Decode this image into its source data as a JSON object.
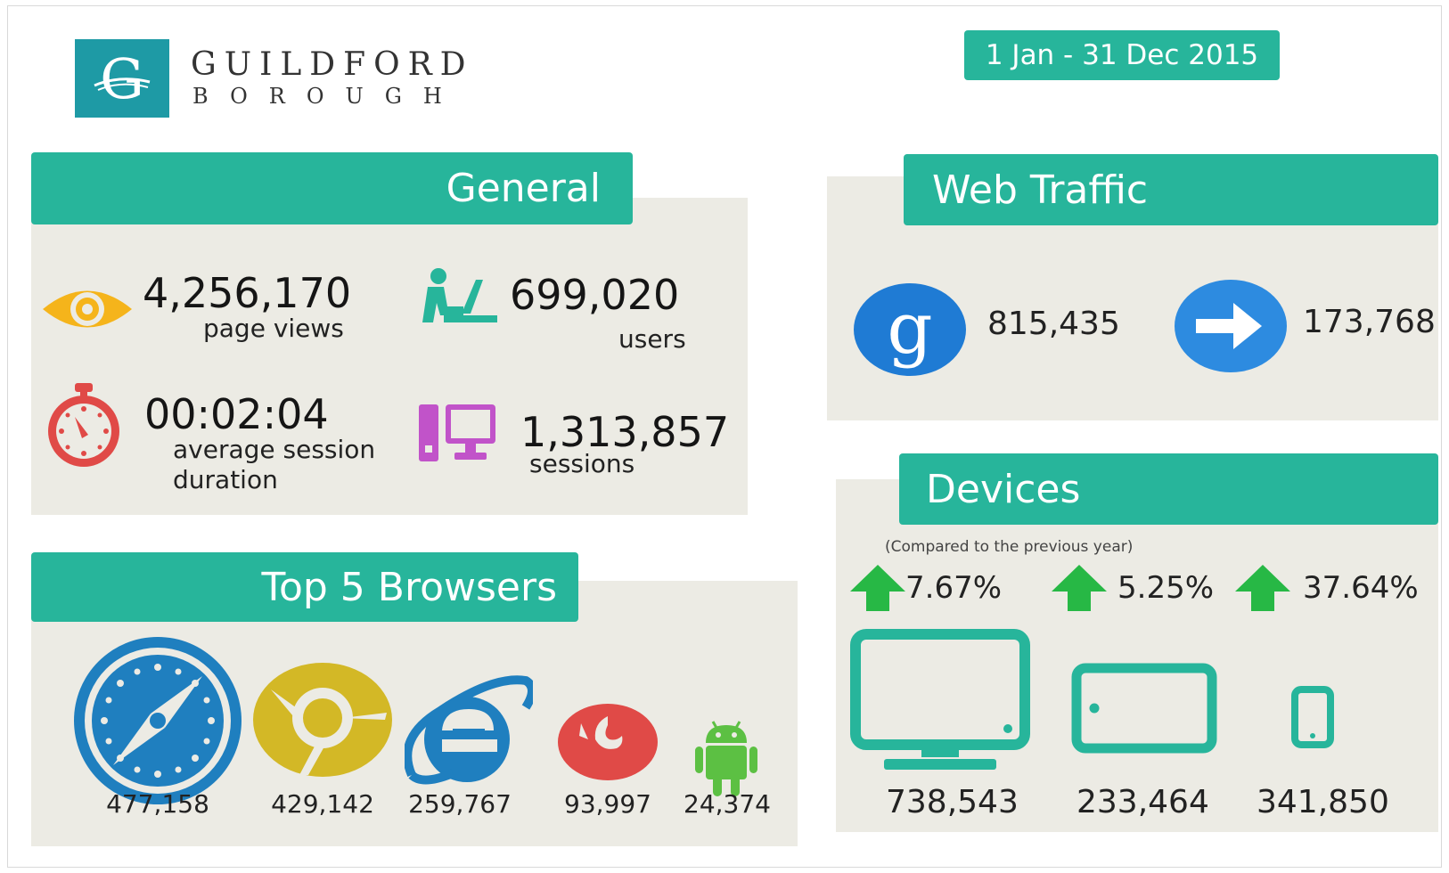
{
  "brand": {
    "line1": "GUILDFORD",
    "line2": "BOROUGH",
    "logo_letter": "G",
    "color": "#1e9aa5"
  },
  "date_range": "1 Jan - 31 Dec 2015",
  "accent_color": "#27b59b",
  "general": {
    "title": "General",
    "page_views": {
      "value": "4,256,170",
      "label": "page views",
      "icon": "eye-icon"
    },
    "users": {
      "value": "699,020",
      "label": "users",
      "icon": "user-at-desk-icon"
    },
    "session_duration": {
      "value": "00:02:04",
      "label_line1": "average session",
      "label_line2": "duration",
      "icon": "stopwatch-icon"
    },
    "sessions": {
      "value": "1,313,857",
      "label": "sessions",
      "icon": "desktop-computer-icon"
    }
  },
  "browsers": {
    "title": "Top 5 Browsers",
    "items": [
      {
        "icon": "safari-icon",
        "value": "477,158"
      },
      {
        "icon": "chrome-icon",
        "value": "429,142"
      },
      {
        "icon": "internet-explorer-icon",
        "value": "259,767"
      },
      {
        "icon": "firefox-icon",
        "value": "93,997"
      },
      {
        "icon": "android-icon",
        "value": "24,374"
      }
    ]
  },
  "web_traffic": {
    "title": "Web Traffic",
    "items": [
      {
        "icon": "google-icon",
        "value": "815,435"
      },
      {
        "icon": "arrow-right-icon",
        "value": "173,768"
      }
    ]
  },
  "devices": {
    "title": "Devices",
    "note": "(Compared to the previous year)",
    "items": [
      {
        "icon": "desktop-monitor-icon",
        "change": "7.67%",
        "value": "738,543"
      },
      {
        "icon": "tablet-icon",
        "change": "5.25%",
        "value": "233,464"
      },
      {
        "icon": "phone-icon",
        "change": "37.64%",
        "value": "341,850"
      }
    ]
  }
}
